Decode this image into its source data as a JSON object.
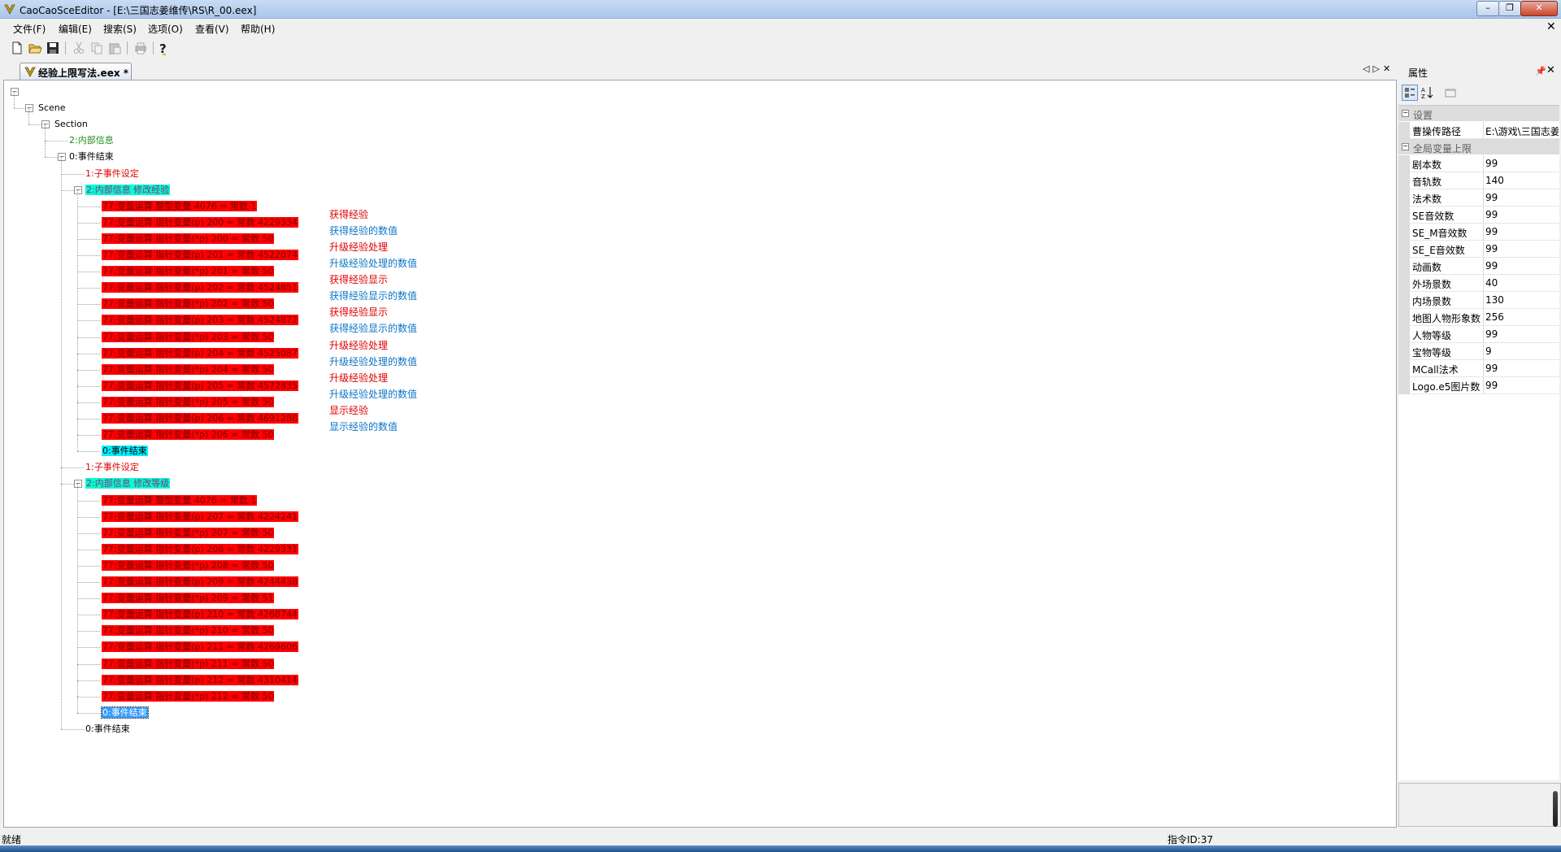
{
  "window": {
    "title": "CaoCaoSceEditor - [E:\\三国志姜维传\\RS\\R_00.eex]"
  },
  "menu": [
    "文件(F)",
    "编辑(E)",
    "搜索(S)",
    "选项(O)",
    "查看(V)",
    "帮助(H)"
  ],
  "toolbar_icons": [
    "new-file-icon",
    "open-folder-icon",
    "save-icon",
    "cut-icon",
    "copy-icon",
    "paste-icon",
    "print-icon",
    "help-icon"
  ],
  "document_tab": {
    "label": "经验上限写法.eex *"
  },
  "tree": {
    "root": "",
    "scene": "Scene",
    "section": "Section",
    "info_node": "2:内部信息",
    "event_end_top": "0:事件结束",
    "sub_event_1": "1:子事件设定",
    "group1": {
      "header": "2:内部信息 修改经验",
      "ops": [
        "77:变量运算 整型变量 4076 = 常数 1",
        "77:变量运算 指针变量(p) 200 = 常数 4229334",
        "77:变量运算 指针变量(*p) 200 = 常数 50",
        "77:变量运算 指针变量(p) 201 = 常数 4522074",
        "77:变量运算 指针变量(*p) 201 = 常数 50",
        "77:变量运算 指针变量(p) 202 = 常数 4524851",
        "77:变量运算 指针变量(*p) 202 = 常数 50",
        "77:变量运算 指针变量(p) 203 = 常数 4524872",
        "77:变量运算 指针变量(*p) 203 = 常数 50",
        "77:变量运算 指针变量(p) 204 = 常数 4525087",
        "77:变量运算 指针变量(*p) 204 = 常数 50",
        "77:变量运算 指针变量(p) 205 = 常数 4572835",
        "77:变量运算 指针变量(*p) 205 = 常数 50",
        "77:变量运算 指针变量(p) 206 = 常数 4691288",
        "77:变量运算 指针变量(*p) 206 = 常数 50"
      ],
      "end": "0:事件结束"
    },
    "sub_event_2": "1:子事件设定",
    "group2": {
      "header": "2:内部信息 修改等级",
      "ops": [
        "77:变量运算 整型变量 4076 = 常数 1",
        "77:变量运算 指针变量(p) 207 = 常数 4224241",
        "77:变量运算 指针变量(*p) 207 = 常数 50",
        "77:变量运算 指针变量(p) 208 = 常数 4229331",
        "77:变量运算 指针变量(*p) 208 = 常数 50",
        "77:变量运算 指针变量(p) 209 = 常数 4244438",
        "77:变量运算 指针变量(*p) 209 = 常数 51",
        "77:变量运算 指针变量(p) 210 = 常数 4268744",
        "77:变量运算 指针变量(*p) 210 = 常数 50",
        "77:变量运算 指针变量(p) 211 = 常数 4269606",
        "77:变量运算 指针变量(*p) 211 = 常数 50",
        "77:变量运算 指针变量(p) 212 = 常数 4310414",
        "77:变量运算 指针变量(*p) 212 = 常数 50"
      ],
      "end": "0:事件结束"
    },
    "event_end_bottom": "0:事件结束"
  },
  "comments": [
    {
      "text": "获得经验",
      "color": "red"
    },
    {
      "text": "获得经验的数值",
      "color": "blue"
    },
    {
      "text": "升级经验处理",
      "color": "red"
    },
    {
      "text": "升级经验处理的数值",
      "color": "blue"
    },
    {
      "text": "获得经验显示",
      "color": "red"
    },
    {
      "text": "获得经验显示的数值",
      "color": "blue"
    },
    {
      "text": "获得经验显示",
      "color": "red"
    },
    {
      "text": "获得经验显示的数值",
      "color": "blue"
    },
    {
      "text": "升级经验处理",
      "color": "red"
    },
    {
      "text": "升级经验处理的数值",
      "color": "blue"
    },
    {
      "text": "升级经验处理",
      "color": "red"
    },
    {
      "text": "升级经验处理的数值",
      "color": "blue"
    },
    {
      "text": "显示经验",
      "color": "red"
    },
    {
      "text": "显示经验的数值",
      "color": "blue"
    }
  ],
  "properties": {
    "title": "属性",
    "categories": [
      {
        "name": "设置",
        "rows": [
          {
            "name": "曹操传路径",
            "value": "E:\\游戏\\三国志姜维"
          }
        ]
      },
      {
        "name": "全局变量上限",
        "rows": [
          {
            "name": "剧本数",
            "value": "99"
          },
          {
            "name": "音轨数",
            "value": "140"
          },
          {
            "name": "法术数",
            "value": "99"
          },
          {
            "name": "SE音效数",
            "value": "99"
          },
          {
            "name": "SE_M音效数",
            "value": "99"
          },
          {
            "name": "SE_E音效数",
            "value": "99"
          },
          {
            "name": "动画数",
            "value": "99"
          },
          {
            "name": "外场景数",
            "value": "40"
          },
          {
            "name": "内场景数",
            "value": "130"
          },
          {
            "name": "地图人物形象数",
            "value": "256"
          },
          {
            "name": "人物等级",
            "value": "99"
          },
          {
            "name": "宝物等级",
            "value": "9"
          },
          {
            "name": "MCall法术",
            "value": "99"
          },
          {
            "name": "Logo.e5图片数",
            "value": "99"
          }
        ]
      }
    ]
  },
  "status": {
    "ready": "就绪",
    "command_id": "指令ID:37"
  },
  "colors": {
    "op_highlight": "#ff0000",
    "header_highlight": "#00ffd2",
    "selection": "#3399ff",
    "comment_red": "#e00000",
    "comment_blue": "#0c74c6"
  }
}
